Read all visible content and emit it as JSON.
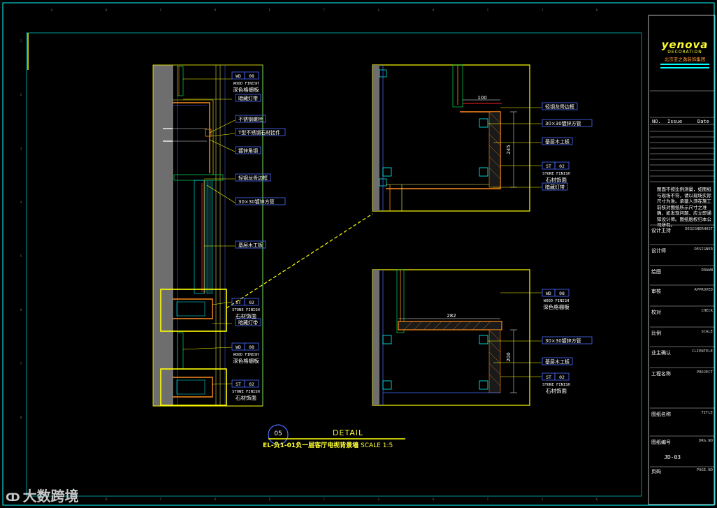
{
  "logo": {
    "brand": "yenova",
    "sub": "DECORATION",
    "company": "北京亚之逸装饰集团"
  },
  "grid": {
    "columns": [
      "A",
      "B",
      "C",
      "D",
      "E",
      "F",
      "G",
      "H",
      "I",
      "J",
      "K"
    ],
    "rows": [
      "1",
      "2",
      "3",
      "4",
      "5",
      "6",
      "7",
      "8"
    ]
  },
  "left_elevation": {
    "tags": [
      {
        "code": "WD",
        "num": "08",
        "en": "WOOD FINISH",
        "cn": "深色格栅板"
      },
      {
        "code": "ST",
        "num": "02",
        "en": "STONE FINISH",
        "cn": "石材饰面"
      },
      {
        "code": "WD",
        "num": "08",
        "en": "WOOD FINISH",
        "cn": "深色格栅板"
      },
      {
        "code": "ST",
        "num": "02",
        "en": "STONE FINISH",
        "cn": "石材饰面"
      }
    ],
    "labels": [
      "暗藏灯带",
      "不锈钢螺栓",
      "T型不锈钢石材挂件",
      "镀锌角钢",
      "轻钢龙骨边框",
      "30×30镀锌方管",
      "基层木工板",
      "暗藏灯带"
    ]
  },
  "detail_top": {
    "dims": [
      "100",
      "245"
    ],
    "labels": [
      "轻钢龙骨边框",
      "30×30镀锌方管",
      "基层木工板",
      "暗藏灯带"
    ],
    "tag": {
      "code": "ST",
      "num": "02",
      "en": "STONE FINISH",
      "cn": "石材饰面"
    }
  },
  "detail_bottom": {
    "dims": [
      "282",
      "200"
    ],
    "labels": [
      "30×30镀锌方管",
      "基层木工板"
    ],
    "tags": [
      {
        "code": "WD",
        "num": "08",
        "en": "WOOD FINISH",
        "cn": "深色格栅板"
      },
      {
        "code": "ST",
        "num": "02",
        "en": "STONE FINISH",
        "cn": "石材饰面"
      }
    ]
  },
  "title_block": {
    "number": "05",
    "title": "DETAIL",
    "subtitle": "EL-负1-01负一层客厅电视背景墙",
    "scale": "SCALE 1:5"
  },
  "sidebar": {
    "rev_headers": [
      "NO.",
      "Issue",
      "Date"
    ],
    "note": "图面不按比例测量，如图纸与现场不符，请以现场实际尺寸为准。承建人须在施工前核对图纸所示尺寸之准确，如发现问题，应立即通知设计师。图纸版权归本公司所有。",
    "rows": [
      {
        "cn": "设计主持",
        "en": "DESIGNERHOST"
      },
      {
        "cn": "设计师",
        "en": "DESIGNER"
      },
      {
        "cn": "绘图",
        "en": "DRAWN"
      },
      {
        "cn": "审核",
        "en": "APPROVED"
      },
      {
        "cn": "校对",
        "en": "CHECK"
      },
      {
        "cn": "比例",
        "en": "SCALE"
      },
      {
        "cn": "业主确认",
        "en": "CLIENTELE"
      },
      {
        "cn": "工程名称",
        "en": "PROJECT"
      },
      {
        "cn": "图纸名称",
        "en": "TITLE"
      },
      {
        "cn": "图纸编号",
        "en": "DRG.NO"
      },
      {
        "cn": "页码",
        "en": "PAGE.NO"
      }
    ],
    "drawing_no": "JD-03"
  },
  "watermark": {
    "text": "大数跨境"
  },
  "colors": {
    "frame": "#00ffff",
    "yellow": "#ffff00",
    "white": "#ffffff",
    "red": "#ff2020",
    "orange": "#ff8c1a",
    "blue": "#4a6cff",
    "concrete": "#7a7a7a"
  }
}
